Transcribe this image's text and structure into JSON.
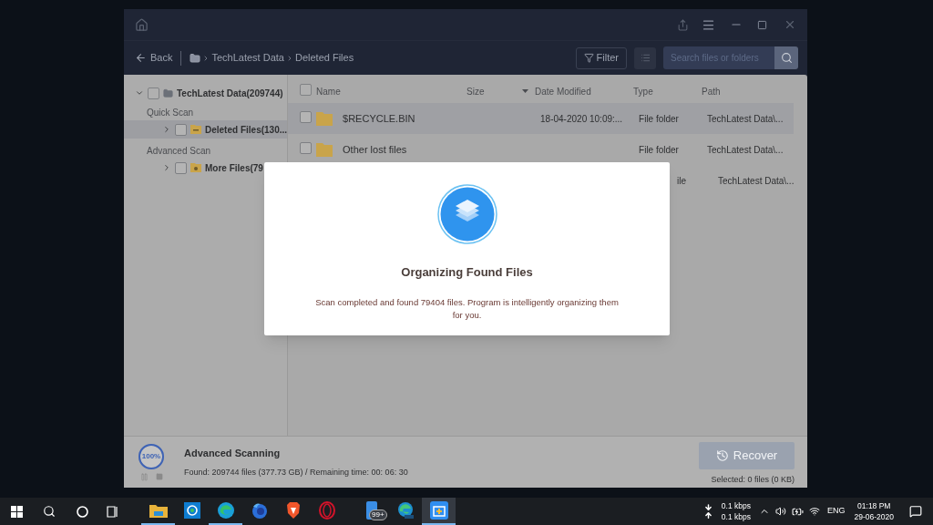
{
  "toolbar": {
    "back": "Back",
    "breadcrumb": [
      "TechLatest Data",
      "Deleted Files"
    ],
    "filter": "Filter",
    "search": {
      "placeholder": "Search files or folders"
    }
  },
  "tree": {
    "label": "TechLatest Data(209744)",
    "expanded": true,
    "checked": false,
    "children": [
      {
        "kind": "group",
        "label": "Quick Scan"
      },
      {
        "kind": "node",
        "label": "Deleted Files(130...",
        "expanded": false,
        "checked": false,
        "selected": true
      },
      {
        "kind": "group",
        "label": "Advanced Scan"
      },
      {
        "kind": "node",
        "label": "More Files(79",
        "expanded": false,
        "checked": false,
        "selected": false
      }
    ]
  },
  "table": {
    "columns": [
      "Name",
      "Size",
      "Date Modified",
      "Type",
      "Path"
    ],
    "header_checked": false,
    "rows": [
      {
        "kind": "full",
        "name": "$RECYCLE.BIN",
        "size": "",
        "date": "18-04-2020 10:09:...",
        "type": "File folder",
        "path": "TechLatest Data\\...",
        "selected": true,
        "checked": false
      },
      {
        "kind": "full",
        "name": "Other lost files",
        "size": "",
        "date": "",
        "type": "File folder",
        "path": "TechLatest Data\\...",
        "selected": false,
        "checked": false
      },
      {
        "kind": "partial",
        "type": "ile",
        "path": "TechLatest Data\\...",
        "selected": false
      }
    ]
  },
  "status": {
    "percent": "100%",
    "level": 1,
    "title": "Advanced Scanning",
    "detail": "Found: 209744 files (377.73 GB) / Remaining time: 00: 06: 30",
    "recover": "Recover",
    "recover_disabled": true,
    "selected": "Selected: 0 files (0 KB)"
  },
  "dialog": {
    "title": "Organizing Found Files",
    "message": "Scan completed and found 79404 files. Program is intelligently organizing them for you."
  },
  "taskbar": {
    "apps": [
      {
        "kind": "explorer",
        "running": true,
        "focused": false
      },
      {
        "kind": "chat",
        "running": false,
        "focused": false
      },
      {
        "kind": "edge",
        "running": true,
        "focused": false
      },
      {
        "kind": "firefox",
        "running": false,
        "focused": false
      },
      {
        "kind": "brave",
        "running": false,
        "focused": false
      },
      {
        "kind": "opera",
        "running": false,
        "focused": false
      },
      {
        "kind": "phone",
        "running": false,
        "focused": false,
        "badge": "99+"
      },
      {
        "kind": "edgebeta",
        "running": false,
        "focused": false
      },
      {
        "kind": "recovery",
        "running": true,
        "focused": true
      }
    ],
    "net_down": "0.1 kbps",
    "net_up": "0.1 kbps",
    "language": "ENG",
    "time": "01:18 PM",
    "date": "29-06-2020"
  }
}
